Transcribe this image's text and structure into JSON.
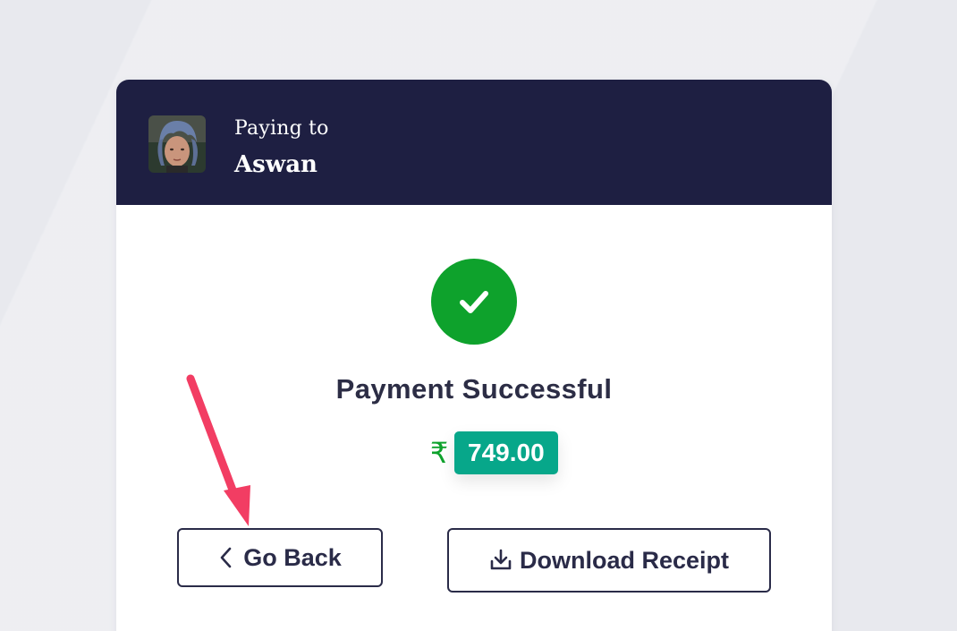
{
  "header": {
    "paying_label": "Paying to",
    "payee_name": "Aswan"
  },
  "status": {
    "title": "Payment Successful",
    "currency_symbol": "₹",
    "amount": "749.00"
  },
  "actions": {
    "back_label": "Go Back",
    "download_label": "Download Receipt"
  },
  "colors": {
    "header_bg": "#1e1f42",
    "success_green": "#0ea22c",
    "amount_badge": "#07a78a",
    "annotation_arrow": "#f23d63"
  },
  "icons": {
    "success": "check-icon",
    "back": "chevron-left-icon",
    "download": "download-icon",
    "annotation": "pointer-arrow-icon"
  }
}
